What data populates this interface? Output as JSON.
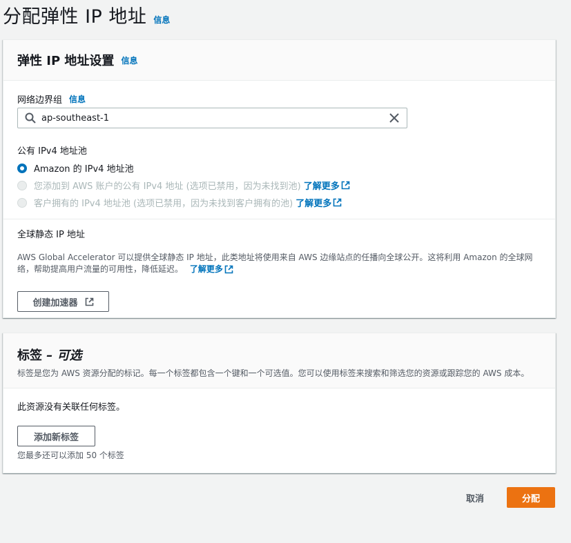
{
  "page": {
    "title": "分配弹性 IP 地址",
    "info": "信息"
  },
  "settings": {
    "header": "弹性 IP 地址设置",
    "header_info": "信息",
    "network_border_group": {
      "label": "网络边界组",
      "info": "信息",
      "value": "ap-southeast-1"
    },
    "ipv4_pool": {
      "label": "公有 IPv4 地址池",
      "options": [
        {
          "label": "Amazon 的 IPv4 地址池",
          "selected": true,
          "disabled": false
        },
        {
          "label": "您添加到 AWS 账户的公有 IPv4 地址 (选项已禁用，因为未找到池)",
          "selected": false,
          "disabled": true,
          "link": "了解更多"
        },
        {
          "label": "客户拥有的 IPv4 地址池 (选项已禁用，因为未找到客户拥有的池)",
          "selected": false,
          "disabled": true,
          "link": "了解更多"
        }
      ]
    },
    "global_static": {
      "label": "全球静态 IP 地址",
      "description": "AWS Global Accelerator 可以提供全球静态 IP 地址，此类地址将使用来自 AWS 边缘站点的任播向全球公开。这将利用 Amazon 的全球网络，帮助提高用户流量的可用性，降低延迟。",
      "link": "了解更多",
      "button": "创建加速器"
    }
  },
  "tags": {
    "header": "标签",
    "header_optional": "– 可选",
    "description": "标签是您为 AWS 资源分配的标记。每一个标签都包含一个键和一个可选值。您可以使用标签来搜索和筛选您的资源或跟踪您的 AWS 成本。",
    "empty_text": "此资源没有关联任何标签。",
    "add_button": "添加新标签",
    "limit_text": "您最多还可以添加 50 个标签"
  },
  "footer": {
    "cancel": "取消",
    "allocate": "分配"
  },
  "colors": {
    "link": "#0073bb",
    "primary": "#ec7211",
    "text": "#16191f",
    "secondary_text": "#545b64",
    "disabled": "#aab7b8"
  }
}
